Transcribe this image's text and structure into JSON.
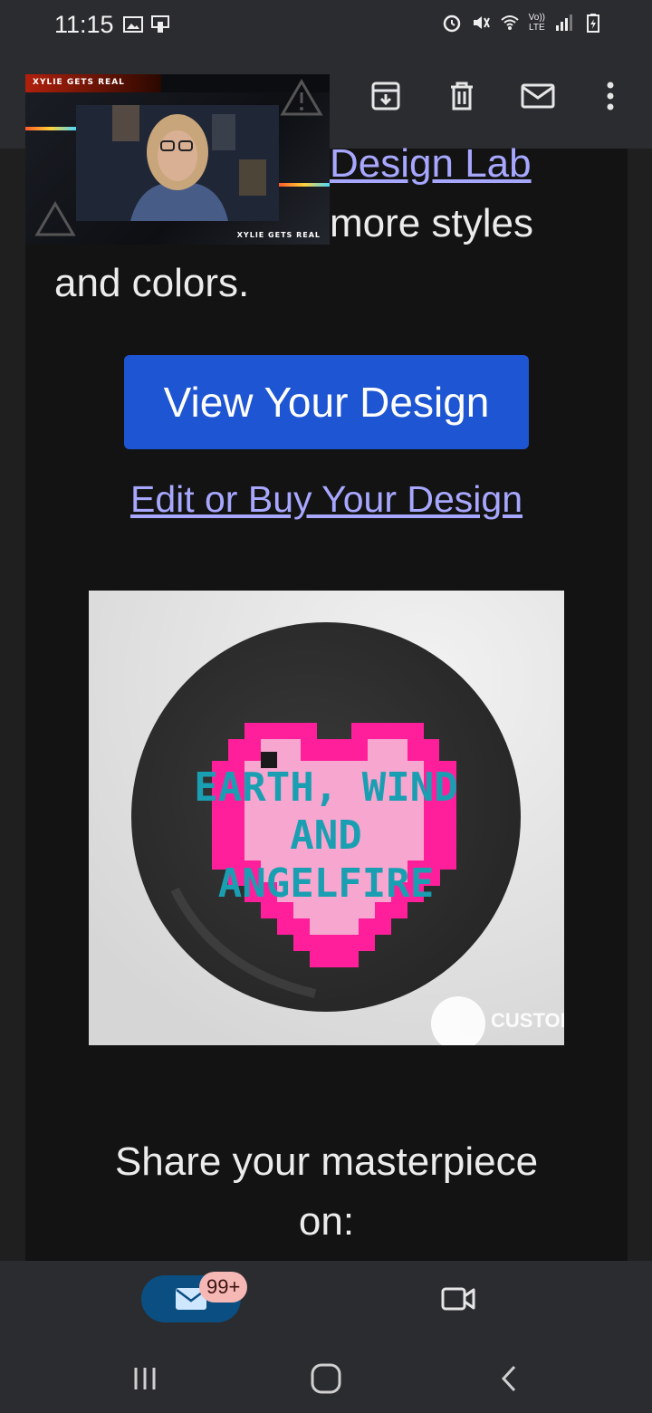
{
  "status_bar": {
    "time": "11:15",
    "lte_label": "LTE",
    "volte_label": "Vo))"
  },
  "toolbar": {
    "icons": [
      "archive-icon",
      "delete-icon",
      "mark-unread-icon",
      "more-options-icon"
    ]
  },
  "video_pip": {
    "top_label": "XYLIE GETS REAL",
    "bottom_label": "XYLIE GETS REAL"
  },
  "email": {
    "partial_link": "Design Lab",
    "partial_line": "more styles",
    "line3": "and colors.",
    "view_button_label": "View Your Design",
    "edit_link_label": "Edit or Buy Your Design",
    "product": {
      "text_line1": "EARTH, WIND",
      "text_line2": "AND",
      "text_line3": "ANGELFIRE",
      "watermark": "CUSTOM INK"
    },
    "share_line1": "Share your masterpiece",
    "share_line2": "on:"
  },
  "bottom_nav": {
    "mail_badge": "99+"
  },
  "colors": {
    "link": "#a7a7ff",
    "button": "#1e55d3",
    "heart_pink": "#ff1f9a",
    "heart_light": "#f7a6cf",
    "text_teal": "#1a9fb2"
  }
}
